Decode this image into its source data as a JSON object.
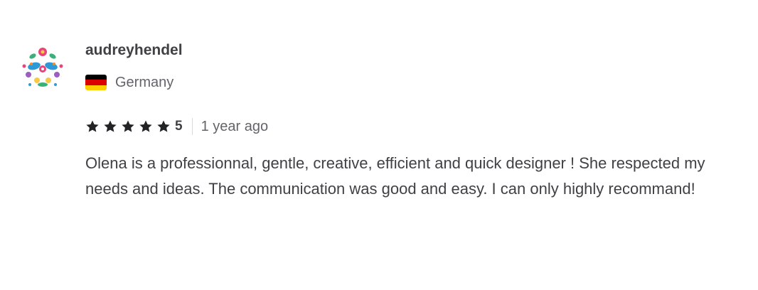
{
  "review": {
    "username": "audreyhendel",
    "country": "Germany",
    "country_flag_colors": [
      "#000000",
      "#dd0000",
      "#ffce00"
    ],
    "rating": 5,
    "rating_label": "5",
    "star_color": "#222325",
    "time_ago": "1 year ago",
    "text": "Olena is a professionnal, gentle, creative, efficient and quick designer ! She respected my needs and ideas. The communication was good and easy. I can only highly recommand!"
  }
}
